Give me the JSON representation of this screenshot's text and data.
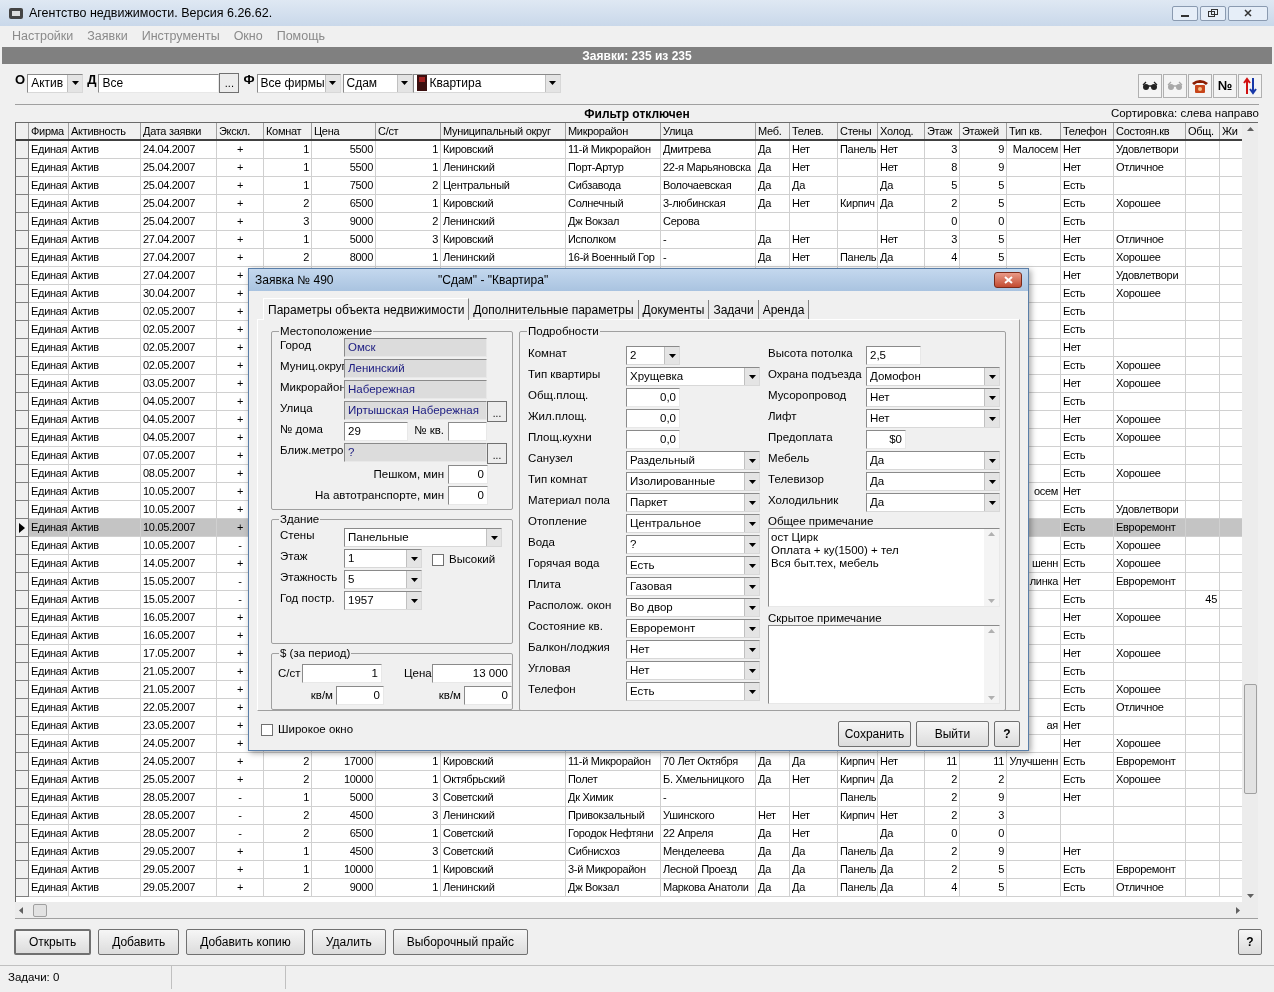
{
  "window": {
    "title": "Агентство недвижимости. Версия 6.26.62."
  },
  "menu": [
    {
      "label": "Настройки",
      "disabled": true
    },
    {
      "label": "Заявки",
      "disabled": true
    },
    {
      "label": "Инструменты",
      "disabled": true
    },
    {
      "label": "Окно",
      "disabled": true
    },
    {
      "label": "Помощь",
      "disabled": true
    }
  ],
  "header_bar": "Заявки: 235 из 235",
  "filters": [
    {
      "kind": "label",
      "text": "О"
    },
    {
      "kind": "combo",
      "value": "Актив"
    },
    {
      "kind": "label",
      "text": "Д"
    },
    {
      "kind": "browse",
      "value": "Все",
      "button": "..."
    },
    {
      "kind": "label",
      "text": "Ф"
    },
    {
      "kind": "combo",
      "value": "Все фирмы"
    },
    {
      "kind": "combo",
      "value": "Сдам"
    },
    {
      "kind": "icon_combo",
      "value": "Квартира"
    }
  ],
  "toolbar": [
    {
      "kind": "glasses",
      "disabled": false
    },
    {
      "kind": "glasses",
      "disabled": true
    },
    {
      "kind": "phone",
      "disabled": false
    },
    {
      "kind": "text",
      "text": "№",
      "disabled": false
    },
    {
      "kind": "sort",
      "disabled": false
    }
  ],
  "filter_status": "Фильтр отключен",
  "sort_note": "Сортировка: слева направо",
  "table": {
    "columns": [
      "Фирма",
      "Активность",
      "Дата заявки",
      "Экскл.",
      "Комнат",
      "Цена",
      "С/ст",
      "Муниципальный округ",
      "Микрорайон",
      "Улица",
      "Меб.",
      "Телев.",
      "Стены",
      "Холод.",
      "Этаж",
      "Этажей",
      "Тип кв.",
      "Телефон",
      "Состоян.кв",
      "Общ.",
      "Жи"
    ],
    "rows": [
      {
        "selected": false,
        "cells": [
          "Единая",
          "Актив",
          "24.04.2007",
          "+",
          "1",
          "5500",
          "1",
          "Кировский",
          "11-й Микрорайон",
          "Дмитрева",
          "Да",
          "Нет",
          "Панель",
          "Нет",
          "3",
          "9",
          "Малосем",
          "Нет",
          "Удовлетвори",
          null,
          null
        ]
      },
      {
        "selected": false,
        "cells": [
          "Единая",
          "Актив",
          "25.04.2007",
          "+",
          "1",
          "5500",
          "1",
          "Ленинский",
          "Порт-Артур",
          "22-я Марьяновска",
          "Да",
          "Нет",
          null,
          "Нет",
          "8",
          "9",
          null,
          "Нет",
          "Отличное",
          null,
          null
        ]
      },
      {
        "selected": false,
        "cells": [
          "Единая",
          "Актив",
          "25.04.2007",
          "+",
          "1",
          "7500",
          "2",
          "Центральный",
          "Сибзавода",
          "Волочаевская",
          "Да",
          "Да",
          null,
          "Да",
          "5",
          "5",
          null,
          "Есть",
          null,
          null,
          null
        ]
      },
      {
        "selected": false,
        "cells": [
          "Единая",
          "Актив",
          "25.04.2007",
          "+",
          "2",
          "6500",
          "1",
          "Кировский",
          "Солнечный",
          "3-любинская",
          "Да",
          "Нет",
          "Кирпич",
          "Да",
          "2",
          "5",
          null,
          "Есть",
          "Хорошее",
          null,
          null
        ]
      },
      {
        "selected": false,
        "cells": [
          "Единая",
          "Актив",
          "25.04.2007",
          "+",
          "3",
          "9000",
          "2",
          "Ленинский",
          "Дж Вокзал",
          "Серова",
          null,
          null,
          null,
          null,
          "0",
          "0",
          null,
          "Есть",
          null,
          null,
          null
        ]
      },
      {
        "selected": false,
        "cells": [
          "Единая",
          "Актив",
          "27.04.2007",
          "+",
          "1",
          "5000",
          "3",
          "Кировский",
          "Исполком",
          "-",
          "Да",
          "Нет",
          null,
          "Нет",
          "3",
          "5",
          null,
          "Нет",
          "Отличное",
          null,
          null
        ]
      },
      {
        "selected": false,
        "cells": [
          "Единая",
          "Актив",
          "27.04.2007",
          "+",
          "2",
          "8000",
          "1",
          "Ленинский",
          "16-й Военный Гор",
          "-",
          "Да",
          "Нет",
          "Панель",
          "Да",
          "4",
          "5",
          null,
          "Есть",
          "Хорошее",
          null,
          null
        ]
      },
      {
        "selected": false,
        "cells": [
          "Единая",
          "Актив",
          "27.04.2007",
          "+",
          null,
          null,
          null,
          null,
          null,
          null,
          null,
          null,
          null,
          null,
          null,
          null,
          null,
          "Нет",
          "Удовлетвори",
          null,
          null
        ]
      },
      {
        "selected": false,
        "cells": [
          "Единая",
          "Актив",
          "30.04.2007",
          "+",
          null,
          null,
          null,
          null,
          null,
          null,
          null,
          null,
          null,
          null,
          null,
          null,
          null,
          "Есть",
          "Хорошее",
          null,
          null
        ]
      },
      {
        "selected": false,
        "cells": [
          "Единая",
          "Актив",
          "02.05.2007",
          "+",
          null,
          null,
          null,
          null,
          null,
          null,
          null,
          null,
          null,
          null,
          null,
          null,
          null,
          "Есть",
          null,
          null,
          null
        ]
      },
      {
        "selected": false,
        "cells": [
          "Единая",
          "Актив",
          "02.05.2007",
          "+",
          null,
          null,
          null,
          null,
          null,
          null,
          null,
          null,
          null,
          null,
          null,
          null,
          null,
          "Есть",
          null,
          null,
          null
        ]
      },
      {
        "selected": false,
        "cells": [
          "Единая",
          "Актив",
          "02.05.2007",
          "+",
          null,
          null,
          null,
          null,
          null,
          null,
          null,
          null,
          null,
          null,
          null,
          null,
          null,
          "Нет",
          null,
          null,
          null
        ]
      },
      {
        "selected": false,
        "cells": [
          "Единая",
          "Актив",
          "02.05.2007",
          "+",
          null,
          null,
          null,
          null,
          null,
          null,
          null,
          null,
          null,
          null,
          null,
          null,
          null,
          "Есть",
          "Хорошее",
          null,
          null
        ]
      },
      {
        "selected": false,
        "cells": [
          "Единая",
          "Актив",
          "03.05.2007",
          "+",
          null,
          null,
          null,
          null,
          null,
          null,
          null,
          null,
          null,
          null,
          null,
          null,
          null,
          "Нет",
          "Хорошее",
          null,
          null
        ]
      },
      {
        "selected": false,
        "cells": [
          "Единая",
          "Актив",
          "04.05.2007",
          "+",
          null,
          null,
          null,
          null,
          null,
          null,
          null,
          null,
          null,
          null,
          null,
          null,
          null,
          "Есть",
          null,
          null,
          null
        ]
      },
      {
        "selected": false,
        "cells": [
          "Единая",
          "Актив",
          "04.05.2007",
          "+",
          null,
          null,
          null,
          null,
          null,
          null,
          null,
          null,
          null,
          null,
          null,
          null,
          null,
          "Нет",
          "Хорошее",
          null,
          null
        ]
      },
      {
        "selected": false,
        "cells": [
          "Единая",
          "Актив",
          "04.05.2007",
          "+",
          null,
          null,
          null,
          null,
          null,
          null,
          null,
          null,
          null,
          null,
          null,
          null,
          null,
          "Есть",
          "Хорошее",
          null,
          null
        ]
      },
      {
        "selected": false,
        "cells": [
          "Единая",
          "Актив",
          "07.05.2007",
          "+",
          null,
          null,
          null,
          null,
          null,
          null,
          null,
          null,
          null,
          null,
          null,
          null,
          null,
          "Есть",
          null,
          null,
          null
        ]
      },
      {
        "selected": false,
        "cells": [
          "Единая",
          "Актив",
          "08.05.2007",
          "+",
          null,
          null,
          null,
          null,
          null,
          null,
          null,
          null,
          null,
          null,
          null,
          null,
          null,
          "Есть",
          "Хорошее",
          null,
          null
        ]
      },
      {
        "selected": false,
        "cells": [
          "Единая",
          "Актив",
          "10.05.2007",
          "+",
          null,
          null,
          null,
          null,
          null,
          null,
          null,
          null,
          null,
          null,
          null,
          null,
          "осем",
          "Нет",
          null,
          null,
          null
        ]
      },
      {
        "selected": false,
        "cells": [
          "Единая",
          "Актив",
          "10.05.2007",
          "+",
          null,
          null,
          null,
          null,
          null,
          null,
          null,
          null,
          null,
          null,
          null,
          null,
          null,
          "Есть",
          "Удовлетвори",
          null,
          null
        ]
      },
      {
        "selected": true,
        "cells": [
          "Единая",
          "Актив",
          "10.05.2007",
          "+",
          null,
          null,
          null,
          null,
          null,
          null,
          null,
          null,
          null,
          null,
          null,
          null,
          null,
          "Есть",
          "Евроремонт",
          null,
          null
        ]
      },
      {
        "selected": false,
        "cells": [
          "Единая",
          "Актив",
          "10.05.2007",
          "-",
          null,
          null,
          null,
          null,
          null,
          null,
          null,
          null,
          null,
          null,
          null,
          null,
          null,
          "Есть",
          "Хорошее",
          null,
          null
        ]
      },
      {
        "selected": false,
        "cells": [
          "Единая",
          "Актив",
          "14.05.2007",
          "+",
          null,
          null,
          null,
          null,
          null,
          null,
          null,
          null,
          null,
          null,
          null,
          null,
          "шенн",
          "Есть",
          "Хорошее",
          null,
          null
        ]
      },
      {
        "selected": false,
        "cells": [
          "Единая",
          "Актив",
          "15.05.2007",
          "-",
          null,
          null,
          null,
          null,
          null,
          null,
          null,
          null,
          null,
          null,
          null,
          null,
          "линка",
          "Нет",
          "Евроремонт",
          null,
          null
        ]
      },
      {
        "selected": false,
        "cells": [
          "Единая",
          "Актив",
          "15.05.2007",
          "-",
          null,
          null,
          null,
          null,
          null,
          null,
          null,
          null,
          null,
          null,
          null,
          null,
          null,
          "Есть",
          null,
          "45",
          null
        ]
      },
      {
        "selected": false,
        "cells": [
          "Единая",
          "Актив",
          "16.05.2007",
          "+",
          null,
          null,
          null,
          null,
          null,
          null,
          null,
          null,
          null,
          null,
          null,
          null,
          null,
          "Нет",
          "Хорошее",
          null,
          null
        ]
      },
      {
        "selected": false,
        "cells": [
          "Единая",
          "Актив",
          "16.05.2007",
          "+",
          null,
          null,
          null,
          null,
          null,
          null,
          null,
          null,
          null,
          null,
          null,
          null,
          null,
          "Есть",
          null,
          null,
          null
        ]
      },
      {
        "selected": false,
        "cells": [
          "Единая",
          "Актив",
          "17.05.2007",
          "+",
          null,
          null,
          null,
          null,
          null,
          null,
          null,
          null,
          null,
          null,
          null,
          null,
          null,
          "Нет",
          "Хорошее",
          null,
          null
        ]
      },
      {
        "selected": false,
        "cells": [
          "Единая",
          "Актив",
          "21.05.2007",
          "+",
          null,
          null,
          null,
          null,
          null,
          null,
          null,
          null,
          null,
          null,
          null,
          null,
          null,
          "Есть",
          null,
          null,
          null
        ]
      },
      {
        "selected": false,
        "cells": [
          "Единая",
          "Актив",
          "21.05.2007",
          "+",
          null,
          null,
          null,
          null,
          null,
          null,
          null,
          null,
          null,
          null,
          null,
          null,
          null,
          "Есть",
          "Хорошее",
          null,
          null
        ]
      },
      {
        "selected": false,
        "cells": [
          "Единая",
          "Актив",
          "22.05.2007",
          "+",
          null,
          null,
          null,
          null,
          null,
          null,
          null,
          null,
          null,
          null,
          null,
          null,
          null,
          "Есть",
          "Отличное",
          null,
          null
        ]
      },
      {
        "selected": false,
        "cells": [
          "Единая",
          "Актив",
          "23.05.2007",
          "+",
          null,
          null,
          null,
          null,
          null,
          null,
          null,
          null,
          null,
          null,
          null,
          null,
          "ая",
          "Нет",
          null,
          null,
          null
        ]
      },
      {
        "selected": false,
        "cells": [
          "Единая",
          "Актив",
          "24.05.2007",
          "+",
          null,
          null,
          null,
          null,
          null,
          null,
          null,
          null,
          null,
          null,
          null,
          null,
          null,
          "Нет",
          "Хорошее",
          null,
          null
        ]
      },
      {
        "selected": false,
        "cells": [
          "Единая",
          "Актив",
          "24.05.2007",
          "+",
          "2",
          "17000",
          "1",
          "Кировский",
          "11-й Микрорайон",
          "70 Лет Октября",
          "Да",
          "Да",
          "Кирпич",
          "Нет",
          "11",
          "11",
          "Улучшенн",
          "Есть",
          "Евроремонт",
          null,
          null
        ]
      },
      {
        "selected": false,
        "cells": [
          "Единая",
          "Актив",
          "25.05.2007",
          "+",
          "2",
          "10000",
          "1",
          "Октябрьский",
          "Полет",
          "Б. Хмельницкого",
          "Да",
          "Нет",
          "Кирпич",
          "Да",
          "2",
          "2",
          null,
          "Есть",
          "Хорошее",
          null,
          null
        ]
      },
      {
        "selected": false,
        "cells": [
          "Единая",
          "Актив",
          "28.05.2007",
          "-",
          "1",
          "5000",
          "3",
          "Советский",
          "Дк Химик",
          "-",
          null,
          null,
          "Панель",
          null,
          "2",
          "9",
          null,
          "Нет",
          null,
          null,
          null
        ]
      },
      {
        "selected": false,
        "cells": [
          "Единая",
          "Актив",
          "28.05.2007",
          "-",
          "2",
          "4500",
          "3",
          "Ленинский",
          "Привокзальный",
          "Ушинского",
          "Нет",
          "Нет",
          "Кирпич",
          "Нет",
          "2",
          "3",
          null,
          null,
          null,
          null,
          null
        ]
      },
      {
        "selected": false,
        "cells": [
          "Единая",
          "Актив",
          "28.05.2007",
          "-",
          "2",
          "6500",
          "1",
          "Советский",
          "Городок Нефтяни",
          "22 Апреля",
          "Да",
          "Нет",
          null,
          "Да",
          "0",
          "0",
          null,
          null,
          null,
          null,
          null
        ]
      },
      {
        "selected": false,
        "cells": [
          "Единая",
          "Актив",
          "29.05.2007",
          "+",
          "1",
          "4500",
          "3",
          "Советский",
          "Сибнисхоз",
          "Менделеева",
          "Да",
          "Да",
          "Панель",
          "Да",
          "2",
          "9",
          null,
          "Нет",
          null,
          null,
          null
        ]
      },
      {
        "selected": false,
        "cells": [
          "Единая",
          "Актив",
          "29.05.2007",
          "+",
          "1",
          "10000",
          "1",
          "Кировский",
          "3-й Микрорайон",
          "Лесной Проезд",
          "Да",
          "Да",
          "Панель",
          "Да",
          "2",
          "5",
          null,
          "Есть",
          "Евроремонт",
          null,
          null
        ]
      },
      {
        "selected": false,
        "cells": [
          "Единая",
          "Актив",
          "29.05.2007",
          "+",
          "2",
          "9000",
          "1",
          "Ленинский",
          "Дж Вокзал",
          "Маркова Анатоли",
          "Да",
          "Да",
          "Панель",
          "Да",
          "4",
          "5",
          null,
          "Есть",
          "Отличное",
          null,
          null
        ]
      }
    ]
  },
  "dialog": {
    "title": "Заявка № 490",
    "subtitle": "\"Сдам\" - \"Квартира\"",
    "tabs": [
      {
        "label": "Параметры объекта недвижимости",
        "selected": true
      },
      {
        "label": "Дополнительные параметры",
        "selected": false
      },
      {
        "label": "Документы",
        "selected": false
      },
      {
        "label": "Задачи",
        "selected": false
      },
      {
        "label": "Аренда",
        "selected": false
      }
    ],
    "location": {
      "title": "Местоположение",
      "fields": [
        {
          "kind": "readonly",
          "label": "Город",
          "value": "Омск"
        },
        {
          "kind": "readonly",
          "label": "Муниц.округ",
          "value": "Ленинский"
        },
        {
          "kind": "readonly",
          "label": "Микрорайон",
          "value": "Набережная"
        },
        {
          "kind": "readonly",
          "label": "Улица",
          "value": "Иртышская Набережная",
          "button": "..."
        },
        {
          "kind": "pair",
          "label": "№ дома",
          "value": "29",
          "label2": "№ кв."
        },
        {
          "kind": "readonly",
          "label": "Ближ.метро",
          "value": "?",
          "button": "..."
        },
        {
          "kind": "number",
          "label": "Пешком, мин",
          "value": "0"
        },
        {
          "kind": "number",
          "label": "На автотранспорте, мин",
          "value": "0"
        }
      ]
    },
    "building": {
      "title": "Здание",
      "fields": [
        {
          "kind": "combo_wide",
          "label": "Стены",
          "value": "Панельные"
        },
        {
          "kind": "combo",
          "label": "Этаж",
          "value": "1",
          "checkbox": {
            "label": "Высокий",
            "checked": false
          }
        },
        {
          "kind": "combo",
          "label": "Этажность",
          "value": "5"
        },
        {
          "kind": "combo",
          "label": "Год постр.",
          "value": "1957"
        }
      ]
    },
    "price": {
      "title": "$ (за период)",
      "rows": [
        [
          {
            "label": "С/ст",
            "value": "1"
          },
          {
            "label": "Цена",
            "value": "13 000"
          }
        ],
        [
          {
            "label": "кв/м",
            "value": "0"
          },
          {
            "label": "кв/м",
            "value": "0"
          }
        ]
      ]
    },
    "details": {
      "title": "Подробности",
      "left": [
        {
          "kind": "combo_small",
          "label": "Комнат",
          "value": "2"
        },
        {
          "kind": "combo",
          "label": "Тип квартиры",
          "value": "Хрущевка"
        },
        {
          "kind": "number",
          "label": "Общ.площ.",
          "value": "0,0"
        },
        {
          "kind": "number",
          "label": "Жил.площ.",
          "value": "0,0"
        },
        {
          "kind": "number",
          "label": "Площ.кухни",
          "value": "0,0"
        },
        {
          "kind": "combo",
          "label": "Санузел",
          "value": "Раздельный"
        },
        {
          "kind": "combo",
          "label": "Тип комнат",
          "value": "Изолированные"
        },
        {
          "kind": "combo",
          "label": "Материал пола",
          "value": "Паркет"
        },
        {
          "kind": "combo",
          "label": "Отопление",
          "value": "Центральное"
        },
        {
          "kind": "combo",
          "label": "Вода",
          "value": "?"
        },
        {
          "kind": "combo",
          "label": "Горячая вода",
          "value": "Есть"
        },
        {
          "kind": "combo",
          "label": "Плита",
          "value": "Газовая"
        },
        {
          "kind": "combo",
          "label": "Располож. окон",
          "value": "Во двор"
        },
        {
          "kind": "combo",
          "label": "Состояние кв.",
          "value": "Евроремонт"
        },
        {
          "kind": "combo",
          "label": "Балкон/лоджия",
          "value": "Нет"
        },
        {
          "kind": "combo",
          "label": "Угловая",
          "value": "Нет"
        },
        {
          "kind": "combo",
          "label": "Телефон",
          "value": "Есть"
        }
      ],
      "right": [
        {
          "kind": "text",
          "label": "Высота потолка",
          "value": "2,5"
        },
        {
          "kind": "combo",
          "label": "Охрана подъезда",
          "value": "Домофон"
        },
        {
          "kind": "combo",
          "label": "Мусоропровод",
          "value": "Нет"
        },
        {
          "kind": "combo",
          "label": "Лифт",
          "value": "Нет"
        },
        {
          "kind": "money",
          "label": "Предоплата",
          "value": "$0"
        },
        {
          "kind": "combo",
          "label": "Мебель",
          "value": "Да"
        },
        {
          "kind": "combo",
          "label": "Телевизор",
          "value": "Да"
        },
        {
          "kind": "combo",
          "label": "Холодильник",
          "value": "Да"
        }
      ],
      "notes": [
        {
          "label": "Общее примечание",
          "text": "ост Цирк\nОплата + ку(1500) + тел\nВся быт.тех, мебель"
        },
        {
          "label": "Скрытое примечание"
        }
      ]
    },
    "wide_window": {
      "label": "Широкое окно",
      "checked": false
    },
    "buttons": [
      "Сохранить",
      "Выйти",
      "?"
    ]
  },
  "bottom_buttons": [
    "Открыть",
    "Добавить",
    "Добавить копию",
    "Удалить",
    "Выборочный прайс"
  ],
  "help_button": "?",
  "status_bar": [
    "Задачи: 0"
  ]
}
